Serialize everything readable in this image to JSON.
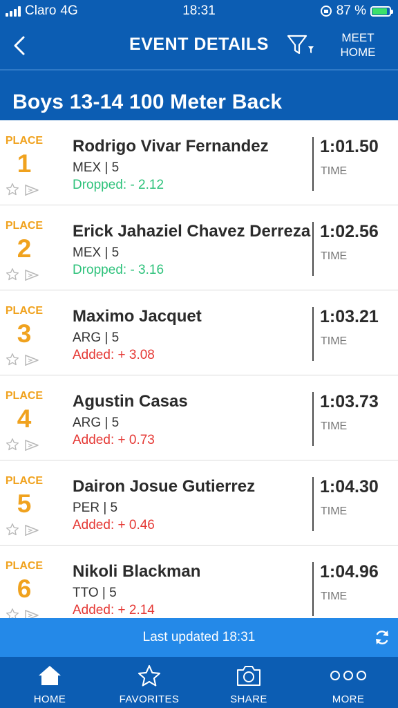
{
  "status_bar": {
    "carrier": "Claro",
    "network": "4G",
    "time": "18:31",
    "battery": "87 %",
    "battery_level": 0.87,
    "battery_color": "#3be06a"
  },
  "nav": {
    "title": "EVENT DETAILS",
    "back_icon": "chevron-left-icon",
    "filter_icon": "filter-icon",
    "meet_home_line1": "MEET",
    "meet_home_line2": "HOME"
  },
  "event": {
    "title": "Boys 13-14 100 Meter Back"
  },
  "results": [
    {
      "place_label": "PLACE",
      "place": "1",
      "name": "Rodrigo Vivar Fernandez",
      "country_heat": "MEX | 5",
      "delta": "Dropped: - 2.12",
      "delta_type": "dropped",
      "time": "1:01.50",
      "time_label": "TIME"
    },
    {
      "place_label": "PLACE",
      "place": "2",
      "name": "Erick Jahaziel Chavez Derreza",
      "country_heat": "MEX | 5",
      "delta": "Dropped: - 3.16",
      "delta_type": "dropped",
      "time": "1:02.56",
      "time_label": "TIME"
    },
    {
      "place_label": "PLACE",
      "place": "3",
      "name": "Maximo Jacquet",
      "country_heat": "ARG | 5",
      "delta": "Added: + 3.08",
      "delta_type": "added",
      "time": "1:03.21",
      "time_label": "TIME"
    },
    {
      "place_label": "PLACE",
      "place": "4",
      "name": "Agustin Casas",
      "country_heat": "ARG | 5",
      "delta": "Added: + 0.73",
      "delta_type": "added",
      "time": "1:03.73",
      "time_label": "TIME"
    },
    {
      "place_label": "PLACE",
      "place": "5",
      "name": "Dairon Josue Gutierrez",
      "country_heat": "PER | 5",
      "delta": "Added: + 0.46",
      "delta_type": "added",
      "time": "1:04.30",
      "time_label": "TIME"
    },
    {
      "place_label": "PLACE",
      "place": "6",
      "name": "Nikoli Blackman",
      "country_heat": "TTO | 5",
      "delta": "Added: + 2.14",
      "delta_type": "added",
      "time": "1:04.96",
      "time_label": "TIME"
    }
  ],
  "updated_bar": {
    "text": "Last updated 18:31",
    "refresh_icon": "refresh-icon"
  },
  "tabs": [
    {
      "label": "HOME",
      "icon": "home-icon"
    },
    {
      "label": "FAVORITES",
      "icon": "star-icon"
    },
    {
      "label": "SHARE",
      "icon": "camera-icon"
    },
    {
      "label": "MORE",
      "icon": "more-icon"
    }
  ],
  "colors": {
    "brand_blue": "#0c5db3",
    "updated_bar_blue": "#2489e8",
    "place_orange": "#f0a21e",
    "dropped_green": "#2ec27b",
    "added_red": "#e53935"
  }
}
